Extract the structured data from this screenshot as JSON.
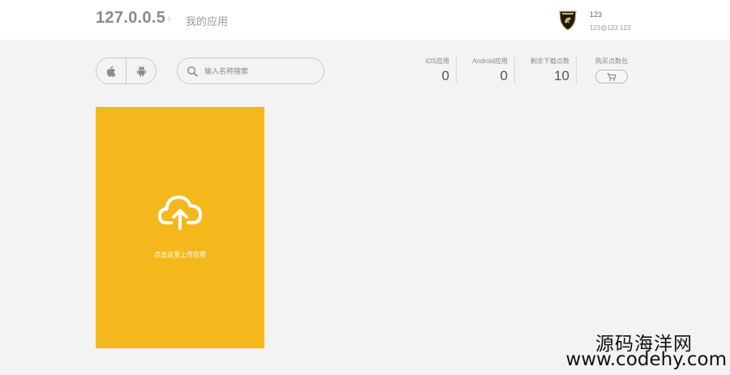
{
  "header": {
    "brand": "127.0.0.5",
    "breadcrumb_separator": "›",
    "breadcrumb": "我的应用",
    "user": {
      "name": "123",
      "email": "123@123.123",
      "avatar_icon": "lamborghini-logo-icon"
    }
  },
  "filters": {
    "platforms": [
      {
        "name": "ios",
        "icon": "apple-icon"
      },
      {
        "name": "android",
        "icon": "android-icon"
      }
    ],
    "search": {
      "placeholder": "输入名称搜索",
      "value": "",
      "icon": "search-icon"
    }
  },
  "stats": [
    {
      "label": "iOS应用",
      "value": "0"
    },
    {
      "label": "Android应用",
      "value": "0"
    },
    {
      "label": "剩余下载点数",
      "value": "10"
    }
  ],
  "purchase": {
    "label": "购买点数包",
    "icon": "cart-icon"
  },
  "upload": {
    "label": "点击这里上传应用",
    "icon": "cloud-upload-icon",
    "color": "#f5b81c"
  },
  "watermark": {
    "line1": "源码海洋网",
    "line2": "www.codehy.com"
  }
}
